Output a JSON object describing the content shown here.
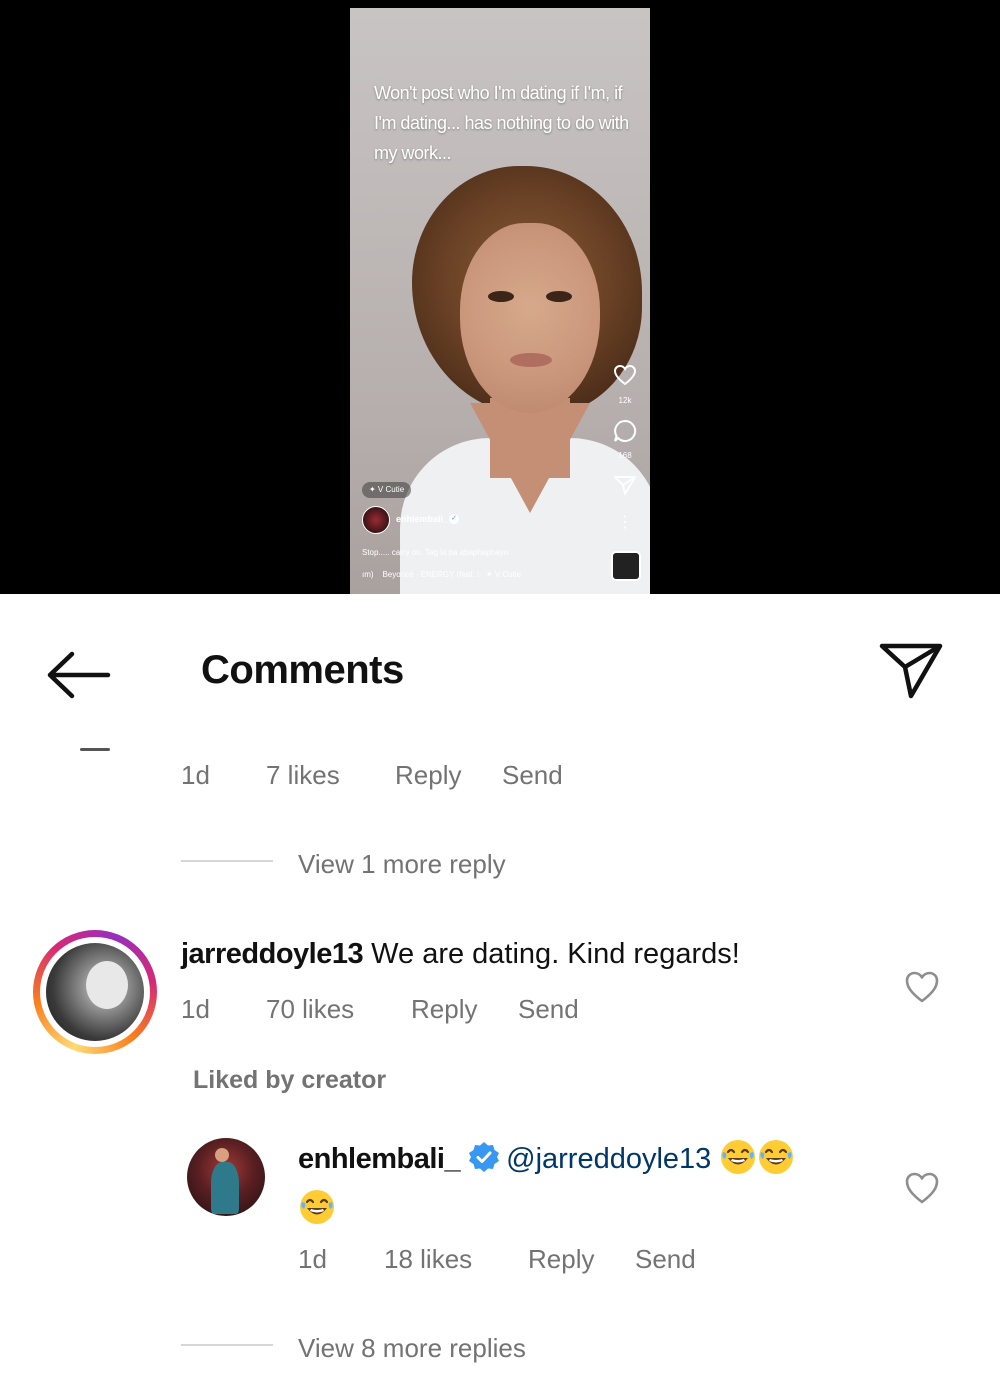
{
  "reel": {
    "overlay_text": "Won't post who I'm dating if I'm, if I'm dating... has nothing to do with my work...",
    "like_count": "12k",
    "comment_count": "168",
    "effect_chip": "✦ V Cutie",
    "username": "enhlembali_",
    "caption": "Stop..... carry on. Tag la ba abaphaphayo",
    "music": "Beyoncé · ENERGY (feat. I",
    "music_effect": "V Cutie",
    "music_prefix": "ım)"
  },
  "header": {
    "title": "Comments",
    "back_icon": "arrow-left-icon",
    "send_icon": "paper-plane-icon"
  },
  "previous_comment": {
    "time": "1d",
    "likes": "7 likes",
    "reply": "Reply",
    "send": "Send",
    "view_replies": "View 1 more reply"
  },
  "comment": {
    "username": "jarreddoyle13",
    "text": "We are dating. Kind regards!",
    "time": "1d",
    "likes": "70 likes",
    "reply": "Reply",
    "send": "Send",
    "liked_by": "Liked by creator"
  },
  "reply": {
    "username": "enhlembali_",
    "mention": "@jarreddoyle13",
    "emoji": "😂😂😂",
    "time": "1d",
    "likes": "18 likes",
    "reply": "Reply",
    "send": "Send",
    "view_replies": "View 8 more replies"
  },
  "colors": {
    "meta_gray": "#737373",
    "verified_blue": "#3897f0",
    "mention_blue": "#00376b"
  }
}
